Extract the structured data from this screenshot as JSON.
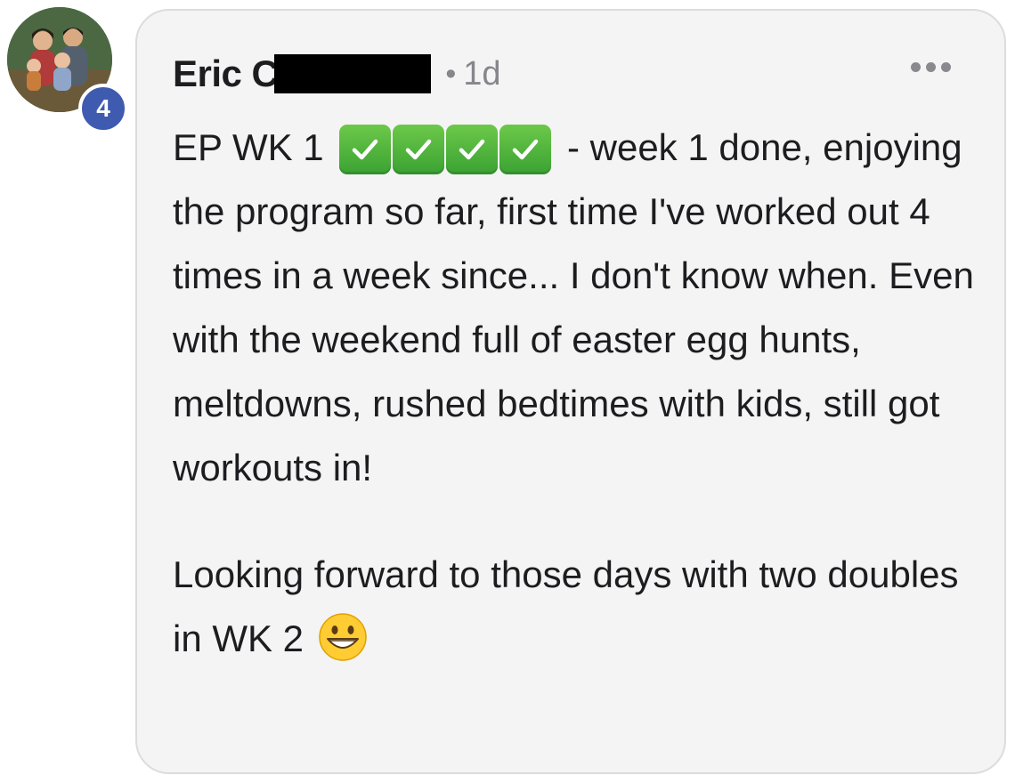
{
  "comment": {
    "author": "Eric C",
    "separator": "•",
    "timestamp": "1d",
    "badge_count": "4",
    "body": {
      "line1_before": "EP WK 1",
      "line1_after": "- week 1 done,",
      "paragraph1_rest": "enjoying the program so far, first time I've worked out 4 times in a week since... I don't know when. Even with the weekend full of easter egg hunts, meltdowns, rushed bedtimes with kids, still got workouts in!",
      "paragraph2": "Looking forward to those days with two doubles in WK 2"
    },
    "check_count": 4,
    "icons": {
      "more": "more-horizontal-icon",
      "check": "check-mark-button-emoji",
      "grin": "grinning-face-emoji"
    },
    "colors": {
      "bubble_bg": "#f4f4f5",
      "badge_bg": "#3f5bb0",
      "check_green": "#3aa232",
      "meta_gray": "#86868b"
    }
  }
}
